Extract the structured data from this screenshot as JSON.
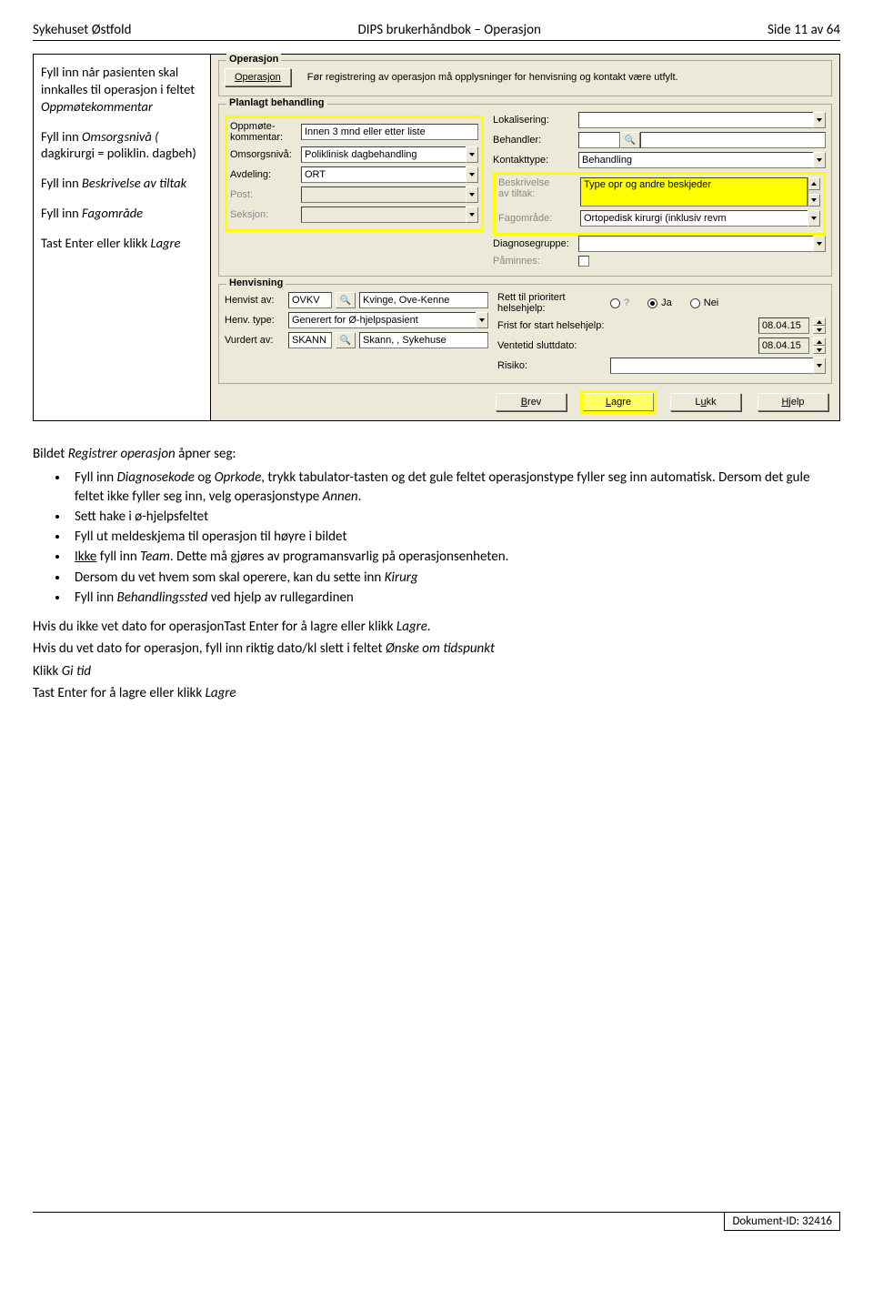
{
  "header": {
    "left": "Sykehuset Østfold",
    "center": "DIPS brukerhåndbok – Operasjon",
    "right": "Side 11 av 64"
  },
  "left_panel": {
    "p1_a": "Fyll inn når pasienten skal innkalles til operasjon i feltet ",
    "p1_b": "Oppmøtekommentar",
    "p2_a": "Fyll inn ",
    "p2_b": "Omsorgsnivå (",
    "p2_c": "dagkirurgi = poliklin. dagbeh)",
    "p3_a": "Fyll inn ",
    "p3_b": "Beskrivelse av tiltak",
    "p4_a": "Fyll inn ",
    "p4_b": "Fagområde",
    "p5_a": "Tast Enter eller klikk ",
    "p5_b": "Lagre"
  },
  "screenshot": {
    "operasjon": {
      "legend": "Operasjon",
      "btn": "Operasjon",
      "info": "Før registrering av operasjon må opplysninger for henvisning og kontakt være utfylt."
    },
    "planlagt": {
      "legend": "Planlagt behandling",
      "labels": {
        "oppmote": "Oppmøte-\nkommentar:",
        "omsorg": "Omsorgsnivå:",
        "avdeling": "Avdeling:",
        "post": "Post:",
        "seksjon": "Seksjon:",
        "lokal": "Lokalisering:",
        "behandler": "Behandler:",
        "kontakt": "Kontakttype:",
        "beskrivelse": "Beskrivelse\nav tiltak:",
        "fag": "Fagområde:",
        "diag": "Diagnosegruppe:",
        "paminnes": "Påminnes:"
      },
      "values": {
        "oppmote": "Innen 3 mnd eller etter liste",
        "omsorg": "Poliklinisk dagbehandling",
        "avdeling": "ORT",
        "kontakt": "Behandling",
        "beskrivelse": "Type opr og andre beskjeder",
        "fag": "Ortopedisk kirurgi (inklusiv revm"
      }
    },
    "henvisning": {
      "legend": "Henvisning",
      "labels": {
        "henvist": "Henvist av:",
        "henvtype": "Henv. type:",
        "vurdert": "Vurdert av:",
        "rett": "Rett til prioritert helsehjelp:",
        "frist": "Frist for start helsehjelp:",
        "ventetid": "Ventetid sluttdato:",
        "risiko": "Risiko:"
      },
      "values": {
        "henvist_code": "OVKV",
        "henvist_name": "Kvinge, Ove-Kenne",
        "henvtype": "Generert for Ø-hjelpspasient",
        "vurdert_code": "SKANN",
        "vurdert_name": "Skann, , Sykehuse",
        "frist": "08.04.15",
        "ventetid": "08.04.15"
      },
      "radios": {
        "q": "?",
        "ja": "Ja",
        "nei": "Nei"
      }
    },
    "buttons": {
      "brev": "Brev",
      "lagre": "Lagre",
      "lukk": "Lukk",
      "hjelp": "Hjelp"
    }
  },
  "below": {
    "intro_a": "Bildet ",
    "intro_b": "Registrer operasjon",
    "intro_c": " åpner seg:",
    "b1_a": "Fyll inn ",
    "b1_b": "Diagnosekode",
    "b1_c": " og ",
    "b1_d": "Oprkode",
    "b1_e": ", trykk tabulator-tasten og det gule feltet operasjonstype fyller seg inn automatisk. Dersom det gule feltet ikke fyller seg inn, velg operasjonstype ",
    "b1_f": "Annen",
    "b1_g": ".",
    "b2": "Sett hake i ø-hjelpsfeltet",
    "b3": "Fyll ut meldeskjema til operasjon til høyre i bildet",
    "b4_a": "Ikke",
    "b4_b": " fyll inn ",
    "b4_c": "Team",
    "b4_d": ". Dette må gjøres av programansvarlig på operasjonsenheten.",
    "b5_a": "Dersom du vet hvem som skal operere, kan du sette inn ",
    "b5_b": "Kirurg",
    "b6_a": "Fyll inn ",
    "b6_b": "Behandlingssted",
    "b6_c": " ved hjelp av rullegardinen",
    "p1_a": "Hvis du ikke vet dato for operasjonTast Enter for å lagre eller klikk ",
    "p1_b": "Lagre.",
    "p2_a": "Hvis du vet dato for operasjon, fyll inn riktig dato/kl slett i feltet ",
    "p2_b": "Ønske om tidspunkt",
    "p3_a": "Klikk ",
    "p3_b": "Gi tid",
    "p4_a": "Tast Enter for å lagre eller klikk ",
    "p4_b": "Lagre"
  },
  "footer": {
    "docid": "Dokument-ID: 32416"
  }
}
